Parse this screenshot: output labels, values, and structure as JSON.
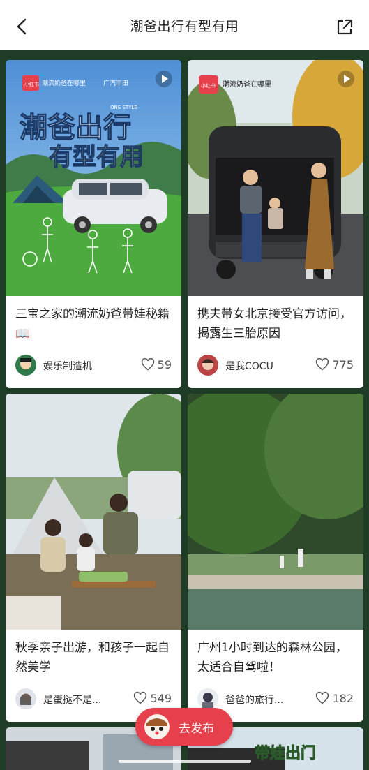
{
  "header": {
    "title": "潮爸出行有型有用"
  },
  "cards": [
    {
      "caption": "三宝之家的潮流奶爸带娃秘籍📖",
      "author": "娱乐制造机",
      "likes": "59"
    },
    {
      "caption": "携夫带女北京接受官方访问，揭露生三胎原因",
      "author": "是我COCU",
      "likes": "775"
    },
    {
      "caption": "秋季亲子出游，和孩子一起自然美学",
      "author": "是蛋挞不是...",
      "likes": "549"
    },
    {
      "caption": "广州1小时到达的森林公园，太适合自驾啦！",
      "author": "爸爸的旅行...",
      "likes": "182"
    }
  ],
  "banner": {
    "brand_xhs": "小红书",
    "brand_logo": "潮流奶爸在哪里",
    "sponsor": "广汽丰田",
    "slogan_line1": "潮爸出行",
    "slogan_line2": "有型有用",
    "tag": "ONE STYLE"
  },
  "card2_badge": {
    "xhs": "小红书",
    "logo": "潮流奶爸在哪里"
  },
  "peek_card": {
    "text": "带娃出门"
  },
  "publish_button": {
    "label": "去发布"
  },
  "icons": {
    "back": "chevron-left-icon",
    "share": "share-icon",
    "like": "heart-icon",
    "play": "play-icon",
    "publish": "mascot-icon"
  },
  "colors": {
    "accent": "#e6404d",
    "background": "#1f3d26",
    "card": "#ffffff"
  }
}
